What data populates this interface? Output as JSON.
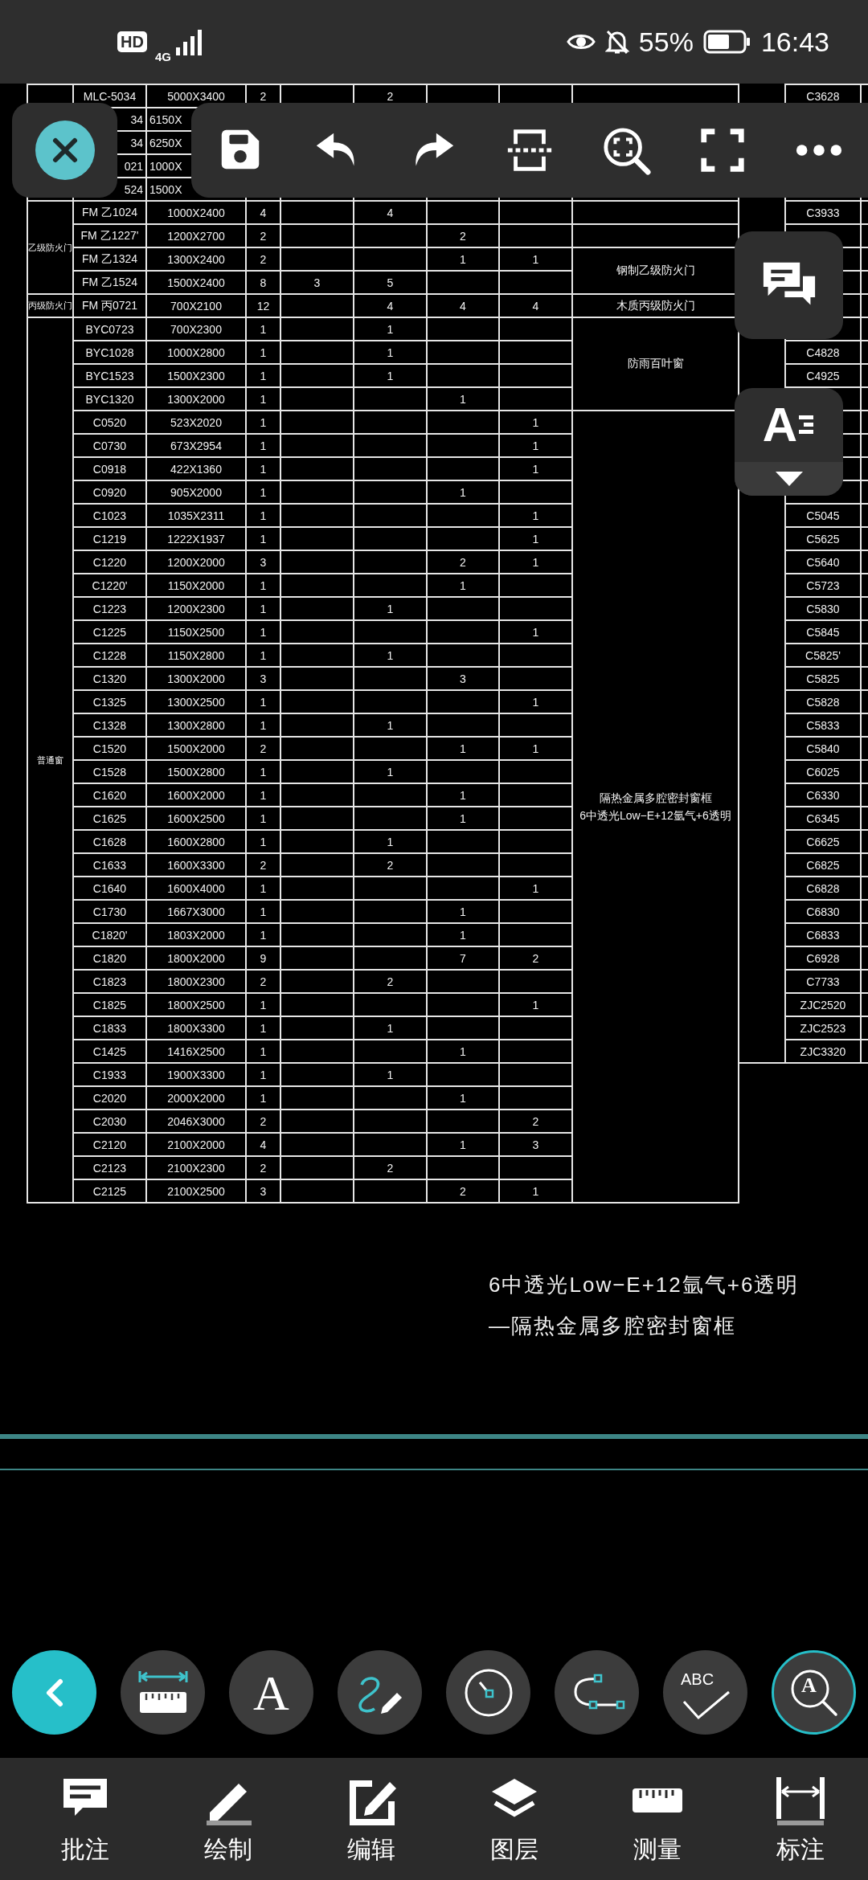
{
  "status_bar": {
    "hd": "HD",
    "network": "4G",
    "battery": "55%",
    "time": "16:43"
  },
  "text_style_button": {
    "glyph": "A"
  },
  "table": {
    "groups": [
      {
        "blocks": [
          {
            "rows": [
              {
                "kind": "full",
                "column_2": "MLC-5034",
                "column_3": "5000X3400",
                "column_4": "2",
                "column_6": "2",
                "column_11": "C3628"
              }
            ]
          },
          {
            "rows": [
              {
                "kind": "covered",
                "column_2": "34",
                "column_3": "6150X"
              }
            ]
          },
          {
            "rows": [
              {
                "kind": "covered",
                "column_2": "34",
                "column_3": "6250X"
              }
            ]
          },
          {
            "rows": [
              {
                "kind": "covered",
                "column_2": "021",
                "column_3": "1000X"
              }
            ]
          },
          {
            "rows": [
              {
                "kind": "covered",
                "column_2": "524",
                "column_3": "1500X"
              }
            ]
          }
        ]
      },
      {
        "label": "乙级防火门",
        "blocks": [
          {
            "rows": [
              {
                "kind": "full",
                "column_2": "FM 乙1024",
                "column_3": "1000X2400",
                "column_4": "4",
                "column_6": "4",
                "column_11": "C3933"
              }
            ]
          },
          {
            "rows": [
              {
                "kind": "full",
                "column_2": "FM 乙1227'",
                "column_3": "1200X2700",
                "column_4": "2",
                "column_7": "2"
              }
            ]
          },
          {
            "note_lines": [
              "钢制乙级防火门"
            ],
            "rows": [
              {
                "kind": "full",
                "column_2": "FM 乙1324",
                "column_3": "1300X2400",
                "column_4": "2",
                "column_7": "1",
                "column_8": "1"
              },
              {
                "kind": "full",
                "column_2": "FM 乙1524",
                "column_3": "1500X2400",
                "column_4": "8",
                "column_5": "3",
                "column_6": "5"
              }
            ]
          }
        ]
      },
      {
        "label": "丙级防火门",
        "blocks": [
          {
            "note_lines": [
              "木质丙级防火门"
            ],
            "rows": [
              {
                "kind": "full",
                "column_2": "FM 丙0721",
                "column_3": "700X2100",
                "column_4": "12",
                "column_6": "4",
                "column_7": "4",
                "column_8": "4"
              }
            ]
          }
        ]
      },
      {
        "label": "普通窗",
        "blocks": [
          {
            "note_lines": [
              "防雨百叶窗"
            ],
            "rows": [
              {
                "kind": "full",
                "column_2": "BYC0723",
                "column_3": "700X2300",
                "column_4": "1",
                "column_6": "1"
              },
              {
                "kind": "full",
                "column_2": "BYC1028",
                "column_3": "1000X2800",
                "column_4": "1",
                "column_6": "1",
                "column_11": "C4828"
              },
              {
                "kind": "full",
                "column_2": "BYC1523",
                "column_3": "1500X2300",
                "column_4": "1",
                "column_6": "1",
                "column_11": "C4925"
              },
              {
                "kind": "full",
                "column_2": "BYC1320",
                "column_3": "1300X2000",
                "column_4": "1",
                "column_7": "1"
              }
            ]
          },
          {
            "note_lines": [
              "隔热金属多腔密封窗框",
              "6中透光Low−E+12氩气+6透明"
            ],
            "rows": [
              {
                "kind": "full",
                "column_2": "C0520",
                "column_3": "523X2020",
                "column_4": "1",
                "column_8": "1"
              },
              {
                "kind": "full",
                "column_2": "C0730",
                "column_3": "673X2954",
                "column_4": "1",
                "column_8": "1"
              },
              {
                "kind": "full",
                "column_2": "C0918",
                "column_3": "422X1360",
                "column_4": "1",
                "column_8": "1"
              },
              {
                "kind": "full",
                "column_2": "C0920",
                "column_3": "905X2000",
                "column_4": "1",
                "column_7": "1"
              },
              {
                "kind": "full",
                "column_2": "C1023",
                "column_3": "1035X2311",
                "column_4": "1",
                "column_8": "1",
                "column_11": "C5045"
              },
              {
                "kind": "full",
                "column_2": "C1219",
                "column_3": "1222X1937",
                "column_4": "1",
                "column_8": "1",
                "column_11": "C5625"
              },
              {
                "kind": "full",
                "column_2": "C1220",
                "column_3": "1200X2000",
                "column_4": "3",
                "column_7": "2",
                "column_8": "1",
                "column_11": "C5640"
              },
              {
                "kind": "full",
                "column_2": "C1220'",
                "column_3": "1150X2000",
                "column_4": "1",
                "column_7": "1",
                "column_11": "C5723"
              },
              {
                "kind": "full",
                "column_2": "C1223",
                "column_3": "1200X2300",
                "column_4": "1",
                "column_6": "1",
                "column_11": "C5830"
              },
              {
                "kind": "full",
                "column_2": "C1225",
                "column_3": "1150X2500",
                "column_4": "1",
                "column_8": "1",
                "column_11": "C5845"
              },
              {
                "kind": "full",
                "column_2": "C1228",
                "column_3": "1150X2800",
                "column_4": "1",
                "column_6": "1",
                "column_11": "C5825'"
              },
              {
                "kind": "full",
                "column_2": "C1320",
                "column_3": "1300X2000",
                "column_4": "3",
                "column_7": "3",
                "column_11": "C5825"
              },
              {
                "kind": "full",
                "column_2": "C1325",
                "column_3": "1300X2500",
                "column_4": "1",
                "column_8": "1",
                "column_11": "C5828"
              },
              {
                "kind": "full",
                "column_2": "C1328",
                "column_3": "1300X2800",
                "column_4": "1",
                "column_6": "1",
                "column_11": "C5833"
              },
              {
                "kind": "full",
                "column_2": "C1520",
                "column_3": "1500X2000",
                "column_4": "2",
                "column_7": "1",
                "column_8": "1",
                "column_11": "C5840"
              },
              {
                "kind": "full",
                "column_2": "C1528",
                "column_3": "1500X2800",
                "column_4": "1",
                "column_6": "1",
                "column_11": "C6025"
              },
              {
                "kind": "full",
                "column_2": "C1620",
                "column_3": "1600X2000",
                "column_4": "1",
                "column_7": "1",
                "column_11": "C6330"
              },
              {
                "kind": "full",
                "column_2": "C1625",
                "column_3": "1600X2500",
                "column_4": "1",
                "column_7": "1",
                "column_11": "C6345"
              },
              {
                "kind": "full",
                "column_2": "C1628",
                "column_3": "1600X2800",
                "column_4": "1",
                "column_6": "1",
                "column_11": "C6625"
              },
              {
                "kind": "full",
                "column_2": "C1633",
                "column_3": "1600X3300",
                "column_4": "2",
                "column_6": "2",
                "column_11": "C6825"
              },
              {
                "kind": "full",
                "column_2": "C1640",
                "column_3": "1600X4000",
                "column_4": "1",
                "column_8": "1",
                "column_11": "C6828"
              },
              {
                "kind": "full",
                "column_2": "C1730",
                "column_3": "1667X3000",
                "column_4": "1",
                "column_7": "1",
                "column_11": "C6830"
              },
              {
                "kind": "full",
                "column_2": "C1820'",
                "column_3": "1803X2000",
                "column_4": "1",
                "column_7": "1",
                "column_11": "C6833"
              },
              {
                "kind": "full",
                "column_2": "C1820",
                "column_3": "1800X2000",
                "column_4": "9",
                "column_7": "7",
                "column_8": "2",
                "column_11": "C6928"
              },
              {
                "kind": "full",
                "column_2": "C1823",
                "column_3": "1800X2300",
                "column_4": "2",
                "column_6": "2",
                "column_11": "C7733"
              },
              {
                "kind": "full",
                "column_2": "C1825",
                "column_3": "1800X2500",
                "column_4": "1",
                "column_8": "1",
                "column_11": "ZJC2520"
              },
              {
                "kind": "full",
                "column_2": "C1833",
                "column_3": "1800X3300",
                "column_4": "1",
                "column_6": "1",
                "column_11": "ZJC2523"
              },
              {
                "kind": "full",
                "column_2": "C1425",
                "column_3": "1416X2500",
                "column_4": "1",
                "column_7": "1",
                "column_11": "ZJC3320"
              },
              {
                "kind": "full",
                "column_2": "C1933",
                "column_3": "1900X3300",
                "column_4": "1",
                "column_6": "1"
              },
              {
                "kind": "full",
                "column_2": "C2020",
                "column_3": "2000X2000",
                "column_4": "1",
                "column_7": "1"
              },
              {
                "kind": "full",
                "column_2": "C2030",
                "column_3": "2046X3000",
                "column_4": "2",
                "column_8": "2"
              },
              {
                "kind": "full",
                "column_2": "C2120",
                "column_3": "2100X2000",
                "column_4": "4",
                "column_7": "1",
                "column_8": "3"
              },
              {
                "kind": "full",
                "column_2": "C2123",
                "column_3": "2100X2300",
                "column_4": "2",
                "column_6": "2"
              },
              {
                "kind": "full",
                "column_2": "C2125",
                "column_3": "2100X2500",
                "column_4": "3",
                "column_7": "2",
                "column_8": "1"
              }
            ]
          }
        ]
      }
    ]
  },
  "annotation_lines": [
    "6中透光Low−E+12氩气+6透明",
    "—隔热金属多腔密封窗框"
  ],
  "tools": [
    {
      "kind": "back",
      "selected": false
    },
    {
      "kind": "measure",
      "selected": false
    },
    {
      "kind": "text",
      "glyph": "A",
      "selected": false
    },
    {
      "kind": "sketch",
      "selected": false
    },
    {
      "kind": "arc",
      "selected": false
    },
    {
      "kind": "curve",
      "selected": false
    },
    {
      "kind": "spellcheck",
      "glyph": "ABC",
      "selected": false
    },
    {
      "kind": "text_search",
      "glyph": "A",
      "selected": true
    }
  ],
  "bottom_nav": [
    {
      "kind": "comment",
      "label": "批注"
    },
    {
      "kind": "draw",
      "label": "绘制"
    },
    {
      "kind": "edit",
      "label": "编辑"
    },
    {
      "kind": "layers",
      "label": "图层"
    },
    {
      "kind": "measure",
      "label": "测量"
    },
    {
      "kind": "dimension",
      "label": "标注"
    }
  ]
}
